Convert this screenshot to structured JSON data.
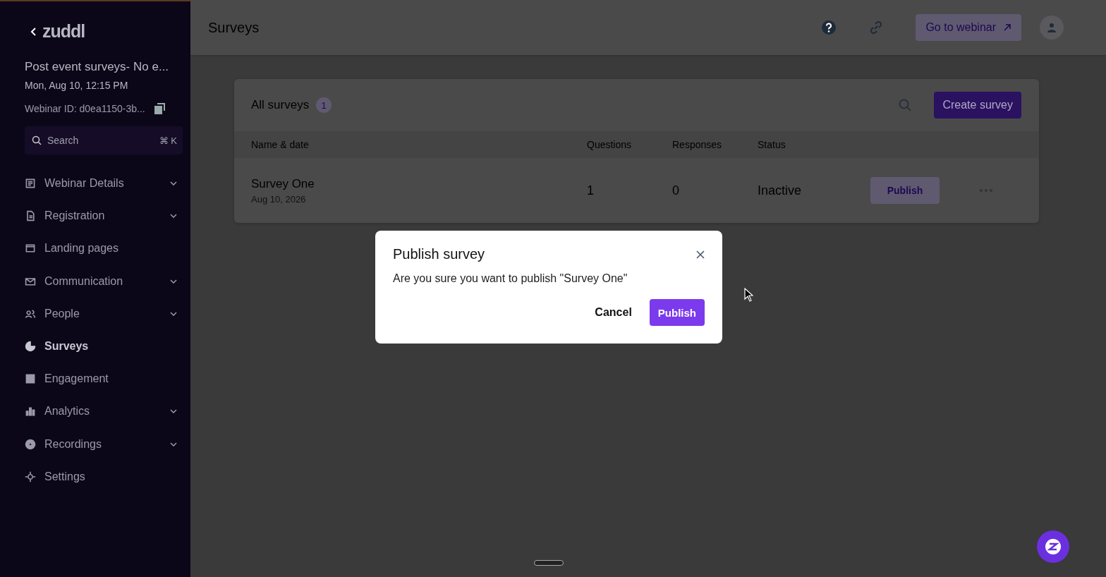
{
  "sidebar": {
    "brand": "zuddl",
    "event_title": "Post event surveys- No e...",
    "event_date": "Mon, Aug 10, 12:15 PM",
    "webinar_id": "Webinar ID: d0ea1150-3b...",
    "search": {
      "placeholder": "Search",
      "shortcut": "⌘ K"
    },
    "items": [
      {
        "label": "Webinar Details",
        "has_submenu": true,
        "selected": false
      },
      {
        "label": "Registration",
        "has_submenu": true,
        "selected": false
      },
      {
        "label": "Landing pages",
        "has_submenu": false,
        "selected": false
      },
      {
        "label": "Communication",
        "has_submenu": true,
        "selected": false
      },
      {
        "label": "People",
        "has_submenu": true,
        "selected": false
      },
      {
        "label": "Surveys",
        "has_submenu": false,
        "selected": true
      },
      {
        "label": "Engagement",
        "has_submenu": false,
        "selected": false
      },
      {
        "label": "Analytics",
        "has_submenu": true,
        "selected": false
      },
      {
        "label": "Recordings",
        "has_submenu": true,
        "selected": false
      },
      {
        "label": "Settings",
        "has_submenu": false,
        "selected": false
      }
    ]
  },
  "header": {
    "title": "Surveys",
    "webinar_button": "Go to webinar"
  },
  "surveys": {
    "title": "All surveys",
    "count": "1",
    "create_button": "Create survey",
    "columns": [
      "Name & date",
      "Questions",
      "Responses",
      "Status"
    ],
    "rows": [
      {
        "name": "Survey One",
        "date": "Aug 10, 2026",
        "questions": "1",
        "responses": "0",
        "status": "Inactive",
        "action": "Publish"
      }
    ]
  },
  "dialog": {
    "title": "Publish survey",
    "message": "Are you sure you want to publish \"Survey One\"",
    "cancel": "Cancel",
    "confirm": "Publish"
  }
}
